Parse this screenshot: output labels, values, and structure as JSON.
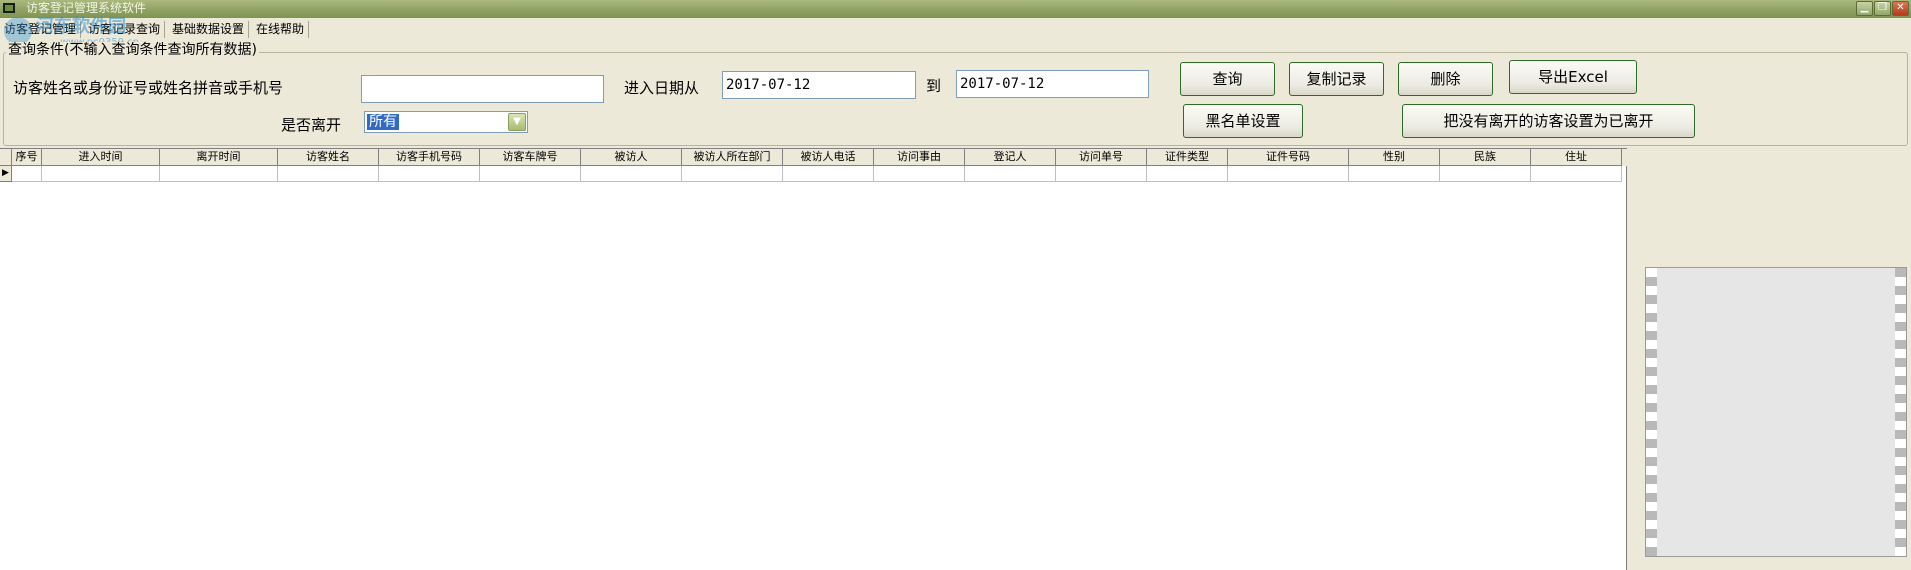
{
  "window": {
    "title": "访客登记管理系统软件",
    "controls": [
      "minimize",
      "restore",
      "close"
    ]
  },
  "menu": {
    "items": [
      "访客登记管理",
      "访客记录查询",
      "基础数据设置",
      "在线帮助"
    ]
  },
  "watermark": {
    "text": "河东软件园",
    "url": "www.pc0359.cn"
  },
  "query": {
    "group_title": "查询条件(不输入查询条件查询所有数据)",
    "name_label": "访客姓名或身份证号或姓名拼音或手机号",
    "name_value": "",
    "date_from_label": "进入日期从",
    "date_from_value": "2017-07-12",
    "date_to_label": "到",
    "date_to_value": "2017-07-12",
    "left_label": "是否离开",
    "left_selected": "所有"
  },
  "buttons": {
    "search": "查询",
    "copy": "复制记录",
    "delete": "删除",
    "export": "导出Excel",
    "blacklist": "黑名单设置",
    "set_left": "把没有离开的访客设置为已离开"
  },
  "grid": {
    "columns": [
      "序号",
      "进入时间",
      "离开时间",
      "访客姓名",
      "访客手机号码",
      "访客车牌号",
      "被访人",
      "被访人所在部门",
      "被访人电话",
      "访问事由",
      "登记人",
      "访问单号",
      "证件类型",
      "证件号码",
      "性别",
      "民族",
      "住址"
    ],
    "rows": []
  },
  "icons": {
    "app": "app-icon",
    "dropdown": "chevron-down-icon",
    "row_indicator": "row-pointer-icon"
  },
  "colors": {
    "titlebar": "#8da060",
    "button_border": "#2f6b26",
    "selection": "#316ac5",
    "background": "#ece9d8"
  }
}
